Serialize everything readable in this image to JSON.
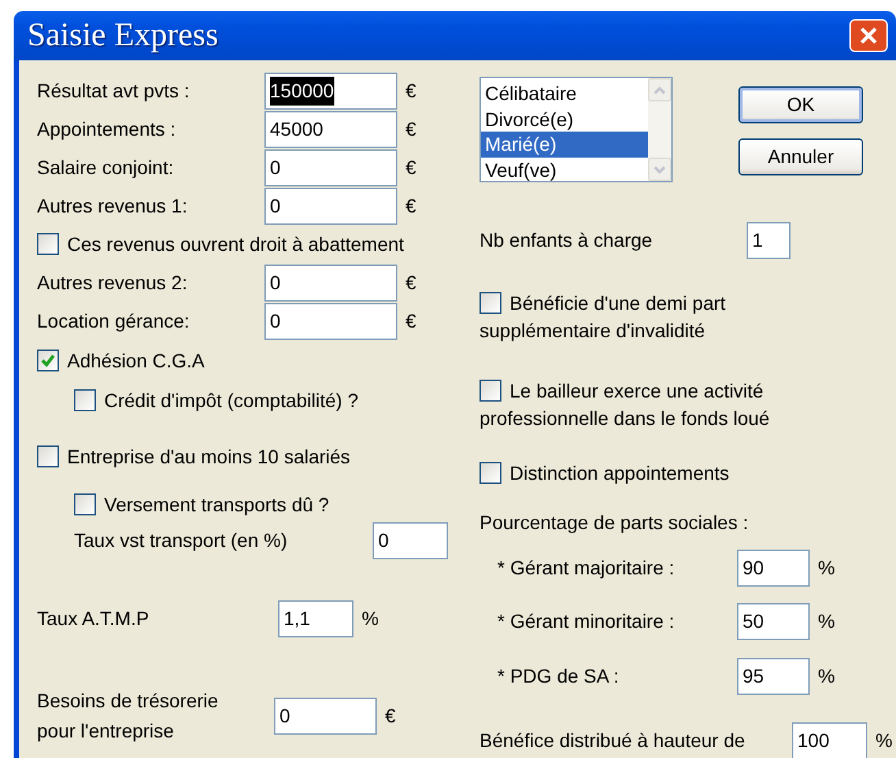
{
  "window": {
    "title": "Saisie Express"
  },
  "left": [
    {
      "kind": "field",
      "label": "Résultat avt pvts :",
      "value": "150000",
      "unit": "€",
      "highlighted": true
    },
    {
      "kind": "field",
      "label": "Appointements :",
      "value": "45000",
      "unit": "€",
      "highlighted": false
    },
    {
      "kind": "field",
      "label": "Salaire conjoint:",
      "value": "0",
      "unit": "€",
      "highlighted": false
    },
    {
      "kind": "field",
      "label": "Autres revenus 1:",
      "value": "0",
      "unit": "€",
      "highlighted": false
    },
    {
      "kind": "checkbox",
      "label": "Ces revenus ouvrent droit à abattement",
      "checked": false
    },
    {
      "kind": "field",
      "label": "Autres revenus 2:",
      "value": "0",
      "unit": "€",
      "highlighted": false
    },
    {
      "kind": "field",
      "label": "Location gérance:",
      "value": "0",
      "unit": "€",
      "highlighted": false
    },
    {
      "kind": "checkbox",
      "label": "Adhésion C.G.A",
      "checked": true
    },
    {
      "kind": "checkbox",
      "label": "Crédit d'impôt (comptabilité) ?",
      "checked": false
    },
    {
      "kind": "checkbox",
      "label": "Entreprise d'au moins 10 salariés",
      "checked": false
    },
    {
      "kind": "checkbox",
      "label": "Versement transports dû ?",
      "checked": false
    },
    {
      "kind": "field",
      "label": "Taux vst transport (en %)",
      "value": "0",
      "highlighted": false
    },
    {
      "kind": "field",
      "label": "Taux  A.T.M.P",
      "value": "1,1",
      "unit": "%",
      "highlighted": false
    },
    {
      "kind": "field",
      "label": "Besoins de trésorerie pour l'entreprise",
      "value": "0",
      "unit": "€",
      "highlighted": false
    }
  ],
  "status_list": [
    {
      "label": "Célibataire",
      "selected": false
    },
    {
      "label": "Divorcé(e)",
      "selected": false
    },
    {
      "label": "Marié(e)",
      "selected": true
    },
    {
      "label": "Veuf(ve)",
      "selected": false
    }
  ],
  "buttons": [
    {
      "label": "OK",
      "default": true
    },
    {
      "label": "Annuler",
      "default": false
    }
  ],
  "right": [
    {
      "kind": "field",
      "label": "Nb enfants à charge",
      "value": "1",
      "highlighted": false
    },
    {
      "kind": "checkbox",
      "label": [
        "Bénéficie d'une demi part",
        "supplémentaire d'invalidité"
      ],
      "checked": false
    },
    {
      "kind": "checkbox",
      "label": [
        "Le bailleur exerce une activité",
        "professionnelle dans le fonds loué"
      ],
      "checked": false
    },
    {
      "kind": "checkbox",
      "label": "Distinction appointements",
      "checked": false
    },
    {
      "kind": "heading",
      "label": "Pourcentage de parts sociales :"
    },
    {
      "kind": "field",
      "label": "* Gérant majoritaire :",
      "value": "90",
      "unit": "%",
      "highlighted": false
    },
    {
      "kind": "field",
      "label": "* Gérant minoritaire :",
      "value": "50",
      "unit": "%",
      "highlighted": false
    },
    {
      "kind": "field",
      "label": "* PDG de SA :",
      "value": "95",
      "unit": "%",
      "highlighted": false
    },
    {
      "kind": "field",
      "label": "Bénéfice distribué à hauteur de",
      "value": "100",
      "unit": "%",
      "highlighted": false
    }
  ]
}
